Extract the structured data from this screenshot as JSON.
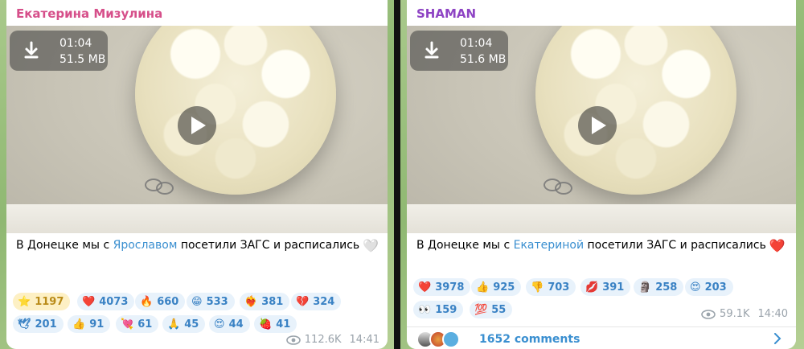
{
  "posts": [
    {
      "author": "Екатерина Мизулина",
      "author_color": "#d64f8a",
      "download": {
        "duration": "01:04",
        "size": "51.5 MB"
      },
      "caption_before": "В Донецке мы с ",
      "caption_link": "Ярославом",
      "caption_after": " посетили ЗАГС и расписались",
      "caption_emoji": "🤍",
      "reactions": [
        {
          "emoji": "⭐",
          "count": "1197"
        },
        {
          "emoji": "❤️",
          "count": "4073"
        },
        {
          "emoji": "🔥",
          "count": "660"
        },
        {
          "emoji": "😁",
          "count": "533"
        },
        {
          "emoji": "❤️‍🔥",
          "count": "381"
        },
        {
          "emoji": "💔",
          "count": "324"
        },
        {
          "emoji": "🕊",
          "count": "201"
        },
        {
          "emoji": "👍",
          "count": "91"
        },
        {
          "emoji": "💘",
          "count": "61"
        },
        {
          "emoji": "🙏",
          "count": "45"
        },
        {
          "emoji": "😍",
          "count": "44"
        },
        {
          "emoji": "🍓",
          "count": "41"
        }
      ],
      "views": "112.6K",
      "time": "14:41"
    },
    {
      "author": "SHAMAN",
      "author_color": "#8e44c4",
      "download": {
        "duration": "01:04",
        "size": "51.6 MB"
      },
      "caption_before": "В Донецке мы с ",
      "caption_link": "Екатериной",
      "caption_after": " посетили ЗАГС и расписались",
      "caption_emoji": "❤️",
      "reactions": [
        {
          "emoji": "❤️",
          "count": "3978"
        },
        {
          "emoji": "👍",
          "count": "925"
        },
        {
          "emoji": "👎",
          "count": "703"
        },
        {
          "emoji": "💋",
          "count": "391"
        },
        {
          "emoji": "🗿",
          "count": "258"
        },
        {
          "emoji": "😍",
          "count": "203"
        },
        {
          "emoji": "👀",
          "count": "159"
        },
        {
          "emoji": "💯",
          "count": "55"
        }
      ],
      "views": "59.1K",
      "time": "14:40",
      "comments": "1652 comments"
    }
  ]
}
